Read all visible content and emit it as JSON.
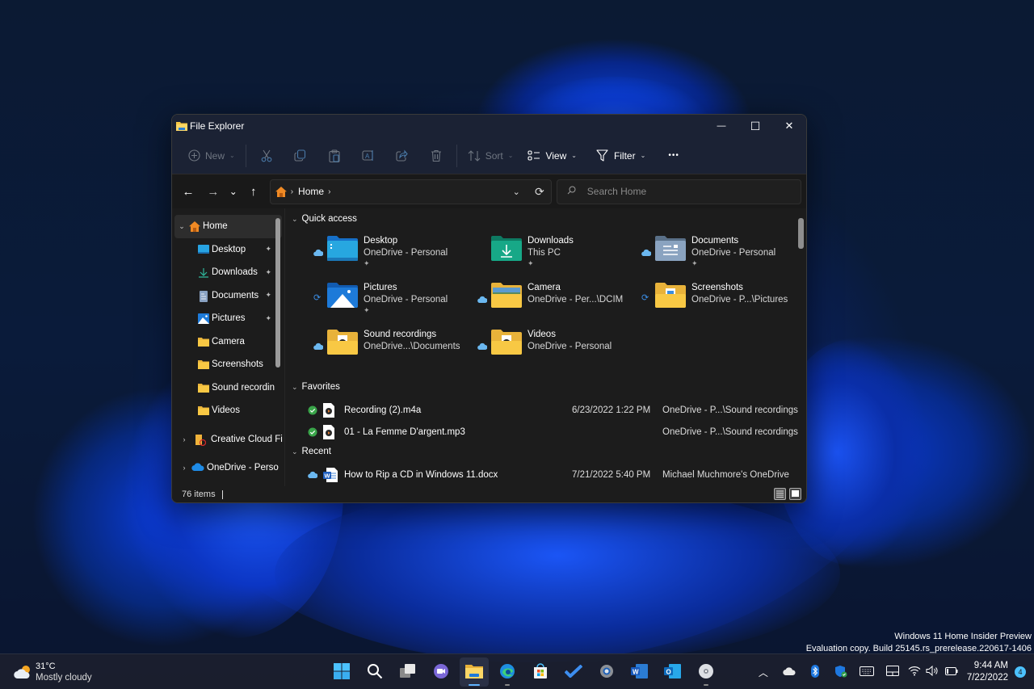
{
  "window": {
    "title": "File Explorer",
    "controls": {
      "minimize": "—",
      "maximize": "☐",
      "close": "✕"
    }
  },
  "toolbar": {
    "new_label": "New",
    "sort_label": "Sort",
    "view_label": "View",
    "filter_label": "Filter",
    "more_label": "•••",
    "icons": [
      "cut-icon",
      "copy-icon",
      "paste-icon",
      "rename-icon",
      "share-icon",
      "delete-icon"
    ]
  },
  "navigation": {
    "back": "←",
    "forward": "→",
    "recent": "⌄",
    "up": "↑",
    "breadcrumb": [
      "Home"
    ],
    "search_placeholder": "Search Home"
  },
  "sidebar": {
    "items": [
      {
        "label": "Home",
        "icon": "home-icon",
        "expanded": true,
        "selected": true
      },
      {
        "label": "Desktop",
        "icon": "desktop-folder-icon",
        "pinned": true
      },
      {
        "label": "Downloads",
        "icon": "downloads-icon",
        "pinned": true
      },
      {
        "label": "Documents",
        "icon": "documents-icon",
        "pinned": true
      },
      {
        "label": "Pictures",
        "icon": "pictures-icon",
        "pinned": true
      },
      {
        "label": "Camera",
        "icon": "folder-icon"
      },
      {
        "label": "Screenshots",
        "icon": "folder-icon"
      },
      {
        "label": "Sound recordin",
        "icon": "folder-icon"
      },
      {
        "label": "Videos",
        "icon": "folder-icon"
      },
      {
        "label": "Creative Cloud Fi",
        "icon": "creative-cloud-icon",
        "collapsed": true
      },
      {
        "label": "OneDrive - Perso",
        "icon": "onedrive-icon",
        "collapsed": true
      }
    ]
  },
  "quick_access": {
    "heading": "Quick access",
    "items": [
      {
        "name": "Desktop",
        "location": "OneDrive - Personal",
        "pinned": true,
        "status": "cloud",
        "icon": "desktop-folder"
      },
      {
        "name": "Downloads",
        "location": "This PC",
        "pinned": true,
        "status": "",
        "icon": "downloads-folder"
      },
      {
        "name": "Documents",
        "location": "OneDrive - Personal",
        "pinned": true,
        "status": "cloud",
        "icon": "documents-folder"
      },
      {
        "name": "Pictures",
        "location": "OneDrive - Personal",
        "pinned": true,
        "status": "sync",
        "icon": "pictures-folder"
      },
      {
        "name": "Camera",
        "location": "OneDrive - Per...\\DCIM",
        "pinned": false,
        "status": "cloud",
        "icon": "camera-folder"
      },
      {
        "name": "Screenshots",
        "location": "OneDrive - P...\\Pictures",
        "pinned": false,
        "status": "sync",
        "icon": "screenshots-folder"
      },
      {
        "name": "Sound recordings",
        "location": "OneDrive...\\Documents",
        "pinned": false,
        "status": "cloud",
        "icon": "media-folder"
      },
      {
        "name": "Videos",
        "location": "OneDrive - Personal",
        "pinned": false,
        "status": "cloud",
        "icon": "media-folder"
      }
    ]
  },
  "favorites": {
    "heading": "Favorites",
    "items": [
      {
        "name": "Recording (2).m4a",
        "date": "6/23/2022 1:22 PM",
        "location": "OneDrive - P...\\Sound recordings",
        "status": "synced"
      },
      {
        "name": "01 - La Femme D'argent.mp3",
        "date": "",
        "location": "OneDrive - P...\\Sound recordings",
        "status": "synced"
      }
    ]
  },
  "recent": {
    "heading": "Recent",
    "items": [
      {
        "name": "How to Rip a CD in Windows 11.docx",
        "date": "7/21/2022 5:40 PM",
        "location": "Michael Muchmore's OneDrive",
        "status": "cloud"
      }
    ]
  },
  "statusbar": {
    "items_count": "76 items"
  },
  "pin_glyph": "📌",
  "taskbar": {
    "weather": {
      "temp": "31°C",
      "condition": "Mostly cloudy"
    },
    "apps": [
      "start",
      "search",
      "task-view",
      "teams-chat",
      "file-explorer",
      "edge",
      "store",
      "todo",
      "settings",
      "word",
      "outlook",
      "cd-player"
    ],
    "active_app": "file-explorer",
    "clock": {
      "time": "9:44 AM",
      "date": "7/22/2022"
    },
    "notifications": "4"
  },
  "watermark": {
    "line1": "Windows 11 Home Insider Preview",
    "line2": "Evaluation copy. Build 25145.rs_prerelease.220617-1406"
  },
  "colors": {
    "accent": "#4cc2ff",
    "folder_yellow": "#f8c844",
    "titlebar": "#1b2234",
    "content_bg": "#1c1c1c",
    "synced_green": "#3aa54a",
    "onedrive_blue": "#6bb8f0"
  }
}
